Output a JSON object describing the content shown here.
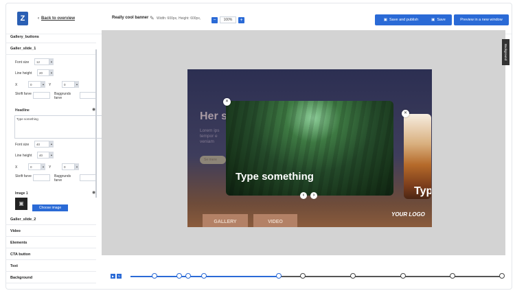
{
  "header": {
    "back_label": "Back to overview",
    "banner_name": "Really cool banner",
    "dimensions": "Width: 600px, Height: 600px,",
    "zoom": "100%",
    "zoom_out_icon": "minus-icon",
    "zoom_in_icon": "plus-icon",
    "buttons": {
      "save_publish": "Save and publish",
      "save": "Save",
      "preview": "Preview in a new window"
    }
  },
  "sidebar": {
    "gallery_buttons": "Gallery_buttons",
    "gallery_slide_1": "Galler_slide_1",
    "font_size_label": "Font size",
    "font_size_value": "12",
    "line_height_label": "Line height",
    "line_height_value": "20",
    "x_label": "X",
    "x_value": "0",
    "y_label": "Y",
    "y_value": "0",
    "skrift_farve": "Skrift farve",
    "baggrunds_farve": "Baggrunds farve",
    "headline_label": "Headline",
    "headline_placeholder": "Type something",
    "font_size_value_2": "40",
    "line_height_value_2": "40",
    "image_label": "Image 1",
    "choose_image": "Choose image",
    "gallery_slide_2": "Galler_slide_2",
    "sections": [
      "Video",
      "Elements",
      "CTA button",
      "Text",
      "Background"
    ]
  },
  "banner": {
    "title_partial": "Her s",
    "subtitle_lines": [
      "Lorem ips",
      "tempor e",
      "veniam"
    ],
    "cta_partial": "Se mere",
    "slide1_text": "Type something",
    "slide2_text_partial": "Typ",
    "logo": "YOUR LOGO",
    "tab_gallery": "GALLERY",
    "tab_video": "VIDEO"
  },
  "side_tab_label": "Background",
  "timeline": {
    "play_icon": "play-icon",
    "loop_icon": "loop-icon"
  },
  "colors": {
    "accent": "#2a6ad6"
  }
}
